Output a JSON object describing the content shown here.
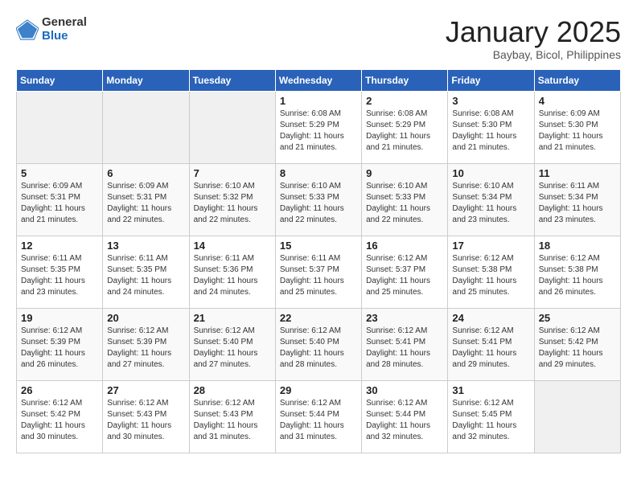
{
  "logo": {
    "general": "General",
    "blue": "Blue"
  },
  "header": {
    "title": "January 2025",
    "subtitle": "Baybay, Bicol, Philippines"
  },
  "weekdays": [
    "Sunday",
    "Monday",
    "Tuesday",
    "Wednesday",
    "Thursday",
    "Friday",
    "Saturday"
  ],
  "weeks": [
    [
      {
        "day": "",
        "data": ""
      },
      {
        "day": "",
        "data": ""
      },
      {
        "day": "",
        "data": ""
      },
      {
        "day": "1",
        "data": "Sunrise: 6:08 AM\nSunset: 5:29 PM\nDaylight: 11 hours and 21 minutes."
      },
      {
        "day": "2",
        "data": "Sunrise: 6:08 AM\nSunset: 5:29 PM\nDaylight: 11 hours and 21 minutes."
      },
      {
        "day": "3",
        "data": "Sunrise: 6:08 AM\nSunset: 5:30 PM\nDaylight: 11 hours and 21 minutes."
      },
      {
        "day": "4",
        "data": "Sunrise: 6:09 AM\nSunset: 5:30 PM\nDaylight: 11 hours and 21 minutes."
      }
    ],
    [
      {
        "day": "5",
        "data": "Sunrise: 6:09 AM\nSunset: 5:31 PM\nDaylight: 11 hours and 21 minutes."
      },
      {
        "day": "6",
        "data": "Sunrise: 6:09 AM\nSunset: 5:31 PM\nDaylight: 11 hours and 22 minutes."
      },
      {
        "day": "7",
        "data": "Sunrise: 6:10 AM\nSunset: 5:32 PM\nDaylight: 11 hours and 22 minutes."
      },
      {
        "day": "8",
        "data": "Sunrise: 6:10 AM\nSunset: 5:33 PM\nDaylight: 11 hours and 22 minutes."
      },
      {
        "day": "9",
        "data": "Sunrise: 6:10 AM\nSunset: 5:33 PM\nDaylight: 11 hours and 22 minutes."
      },
      {
        "day": "10",
        "data": "Sunrise: 6:10 AM\nSunset: 5:34 PM\nDaylight: 11 hours and 23 minutes."
      },
      {
        "day": "11",
        "data": "Sunrise: 6:11 AM\nSunset: 5:34 PM\nDaylight: 11 hours and 23 minutes."
      }
    ],
    [
      {
        "day": "12",
        "data": "Sunrise: 6:11 AM\nSunset: 5:35 PM\nDaylight: 11 hours and 23 minutes."
      },
      {
        "day": "13",
        "data": "Sunrise: 6:11 AM\nSunset: 5:35 PM\nDaylight: 11 hours and 24 minutes."
      },
      {
        "day": "14",
        "data": "Sunrise: 6:11 AM\nSunset: 5:36 PM\nDaylight: 11 hours and 24 minutes."
      },
      {
        "day": "15",
        "data": "Sunrise: 6:11 AM\nSunset: 5:37 PM\nDaylight: 11 hours and 25 minutes."
      },
      {
        "day": "16",
        "data": "Sunrise: 6:12 AM\nSunset: 5:37 PM\nDaylight: 11 hours and 25 minutes."
      },
      {
        "day": "17",
        "data": "Sunrise: 6:12 AM\nSunset: 5:38 PM\nDaylight: 11 hours and 25 minutes."
      },
      {
        "day": "18",
        "data": "Sunrise: 6:12 AM\nSunset: 5:38 PM\nDaylight: 11 hours and 26 minutes."
      }
    ],
    [
      {
        "day": "19",
        "data": "Sunrise: 6:12 AM\nSunset: 5:39 PM\nDaylight: 11 hours and 26 minutes."
      },
      {
        "day": "20",
        "data": "Sunrise: 6:12 AM\nSunset: 5:39 PM\nDaylight: 11 hours and 27 minutes."
      },
      {
        "day": "21",
        "data": "Sunrise: 6:12 AM\nSunset: 5:40 PM\nDaylight: 11 hours and 27 minutes."
      },
      {
        "day": "22",
        "data": "Sunrise: 6:12 AM\nSunset: 5:40 PM\nDaylight: 11 hours and 28 minutes."
      },
      {
        "day": "23",
        "data": "Sunrise: 6:12 AM\nSunset: 5:41 PM\nDaylight: 11 hours and 28 minutes."
      },
      {
        "day": "24",
        "data": "Sunrise: 6:12 AM\nSunset: 5:41 PM\nDaylight: 11 hours and 29 minutes."
      },
      {
        "day": "25",
        "data": "Sunrise: 6:12 AM\nSunset: 5:42 PM\nDaylight: 11 hours and 29 minutes."
      }
    ],
    [
      {
        "day": "26",
        "data": "Sunrise: 6:12 AM\nSunset: 5:42 PM\nDaylight: 11 hours and 30 minutes."
      },
      {
        "day": "27",
        "data": "Sunrise: 6:12 AM\nSunset: 5:43 PM\nDaylight: 11 hours and 30 minutes."
      },
      {
        "day": "28",
        "data": "Sunrise: 6:12 AM\nSunset: 5:43 PM\nDaylight: 11 hours and 31 minutes."
      },
      {
        "day": "29",
        "data": "Sunrise: 6:12 AM\nSunset: 5:44 PM\nDaylight: 11 hours and 31 minutes."
      },
      {
        "day": "30",
        "data": "Sunrise: 6:12 AM\nSunset: 5:44 PM\nDaylight: 11 hours and 32 minutes."
      },
      {
        "day": "31",
        "data": "Sunrise: 6:12 AM\nSunset: 5:45 PM\nDaylight: 11 hours and 32 minutes."
      },
      {
        "day": "",
        "data": ""
      }
    ]
  ]
}
